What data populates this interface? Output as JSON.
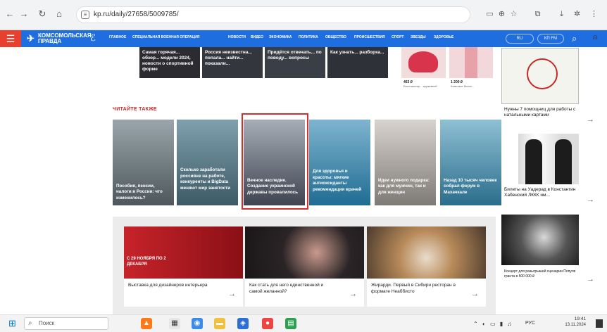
{
  "browser": {
    "url": "kp.ru/daily/27658/5009785/",
    "icons": [
      "back-icon",
      "forward-icon",
      "reload-icon",
      "home-icon",
      "tune-icon",
      "cast-icon",
      "zoom-icon",
      "star-icon",
      "extensions-icon",
      "download-icon",
      "menu-icon"
    ]
  },
  "site": {
    "logo_line1": "КОМСОМОЛЬСКАЯ",
    "logo_line2": "ПРАВДА",
    "menu": [
      "ГЛАВНОЕ",
      "СПЕЦИАЛЬНАЯ ВОЕННАЯ ОПЕРАЦИЯ",
      "НОВОСТИ",
      "ВИДЕО",
      "ЭКОНОМИКА",
      "ПОЛИТИКА",
      "ОБЩЕСТВО",
      "ПРОИСШЕСТВИЯ",
      "СПОРТ",
      "ЗВЕЗДЫ",
      "ЗДОРОВЬЕ"
    ],
    "region_label": "RU",
    "radio_label": "КП FM",
    "accent": "#1f6ee0",
    "burger_color": "#e8402f"
  },
  "top_strip": [
    {
      "text": "Самая горячая... обзор... модели 2024, новости о спортивной форме"
    },
    {
      "text": "Россия неизвестна... попала... найти... показали..."
    },
    {
      "text": "Придётся отвечать... по поводу... вопросы"
    },
    {
      "text": "Как узнать... разборка..."
    }
  ],
  "products": [
    {
      "price": "463 ₽",
      "desc": "Бюстгальтер... кружевной"
    },
    {
      "price": "1 200 ₽",
      "desc": "Комплект белья..."
    }
  ],
  "section_title": "ЧИТАЙТЕ ТАКЖЕ",
  "tiles": [
    {
      "title": "Пособия, пенсии, налоги в России: что изменилось?",
      "color": "#7a8a8f"
    },
    {
      "title": "Сколько заработали россияне на работе, конкуренты и BigData меняют мир занятости",
      "color": "#5f7f8a"
    },
    {
      "title": "Вечное наследие. Создание украинской державы провалилось",
      "color": "#6a7280"
    },
    {
      "title": "Для здоровья и красоты: мягкие антиоксиданты рекомендации врачей",
      "color": "#2f7fa6"
    },
    {
      "title": "Идеи нужного подарка: как для мужчин, так и для женщин",
      "color": "#b9b3ad"
    },
    {
      "title": "Назад 10 тысяч человек собрал форум в Махачкале",
      "color": "#3f8aa8"
    }
  ],
  "bottom_cards": [
    {
      "title": "Выставка для дизайнеров интерьера",
      "banner": "С 29 НОЯБРЯ ПО 2 ДЕКАБРЯ"
    },
    {
      "title": "Как стать для него единственной и самой желанной?"
    },
    {
      "title": "Жирарди. Первый в Сибири ресторан в формате Неаббисто"
    }
  ],
  "sidebar": [
    {
      "title": "Нужны 7 помощниц для работы с натальными картами"
    },
    {
      "title": "Билеты на Уадерад в Константин Хабенский ЛККК им..."
    },
    {
      "title": "Концерт для разыгрышей сценарии Популя гранта в 500 000 ₽"
    }
  ],
  "taskbar": {
    "search_placeholder": "Поиск",
    "lang": "РУС",
    "time": "19:41",
    "date": "13.11.2024"
  }
}
